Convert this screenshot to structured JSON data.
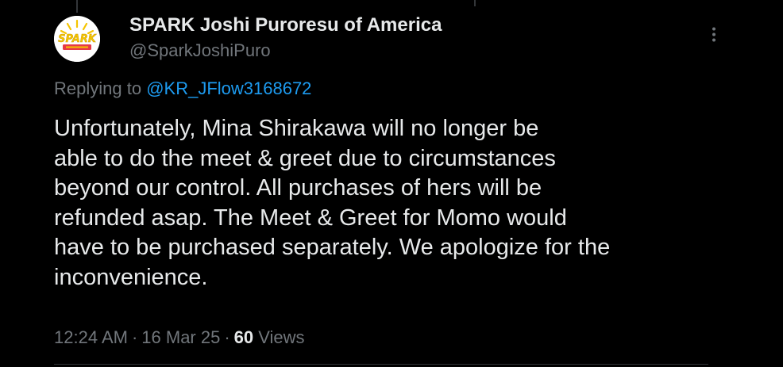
{
  "author": {
    "display_name": "SPARK Joshi Puroresu of America",
    "handle": "@SparkJoshiPuro",
    "avatar_logo_text": "SPARK",
    "avatar_colors": {
      "background": "#ffffff",
      "burst": "#f5c400",
      "text": "#f5c400",
      "ribbon": "#e63946"
    }
  },
  "reply": {
    "prefix": "Replying to ",
    "mention": "@KR_JFlow3168672"
  },
  "tweet": {
    "lines": [
      "Unfortunately, Mina Shirakawa will no longer be",
      "able to do the meet & greet due to circumstances",
      "beyond our control. All purchases of hers will be",
      "refunded asap. The Meet & Greet for Momo would",
      "have to be purchased separately. We apologize for the",
      "inconvenience."
    ]
  },
  "meta": {
    "time": "12:24 AM",
    "separator": "·",
    "date": "16 Mar 25",
    "views_count": "60",
    "views_label": " Views"
  },
  "icons": {
    "more": "more-vertical-icon"
  },
  "colors": {
    "background": "#000000",
    "primary_text": "#e7e9ea",
    "secondary_text": "#71767b",
    "link": "#1d9bf0",
    "divider": "#2f3336"
  }
}
